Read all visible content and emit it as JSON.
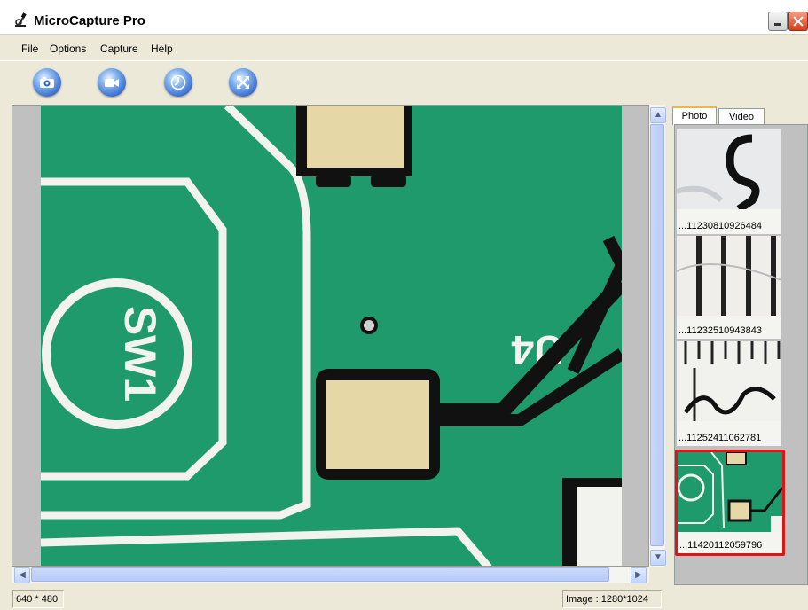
{
  "window": {
    "title": "MicroCapture Pro"
  },
  "menu": [
    "File",
    "Options",
    "Capture",
    "Help"
  ],
  "toolbar": {
    "buttons": [
      {
        "name": "photo-capture-button",
        "icon": "camera-icon"
      },
      {
        "name": "video-record-button",
        "icon": "video-camera-icon"
      },
      {
        "name": "timer-button",
        "icon": "clock-icon"
      },
      {
        "name": "fullscreen-button",
        "icon": "expand-arrows-icon"
      }
    ]
  },
  "tabs": {
    "photo": "Photo",
    "video": "Video",
    "active": "Photo"
  },
  "thumbnails": [
    {
      "caption": "...11230810926484",
      "selected": false
    },
    {
      "caption": "...11232510943843",
      "selected": false
    },
    {
      "caption": "...11252411062781",
      "selected": false
    },
    {
      "caption": "...11420112059796",
      "selected": true
    }
  ],
  "status": {
    "resolution": "640 * 480",
    "image": "Image : 1280*1024"
  },
  "colors": {
    "pcb_green": "#1f9a6c",
    "trace_white": "#f2f2ee",
    "pad_gold": "#e6d7a6",
    "selection": "#e01414"
  }
}
